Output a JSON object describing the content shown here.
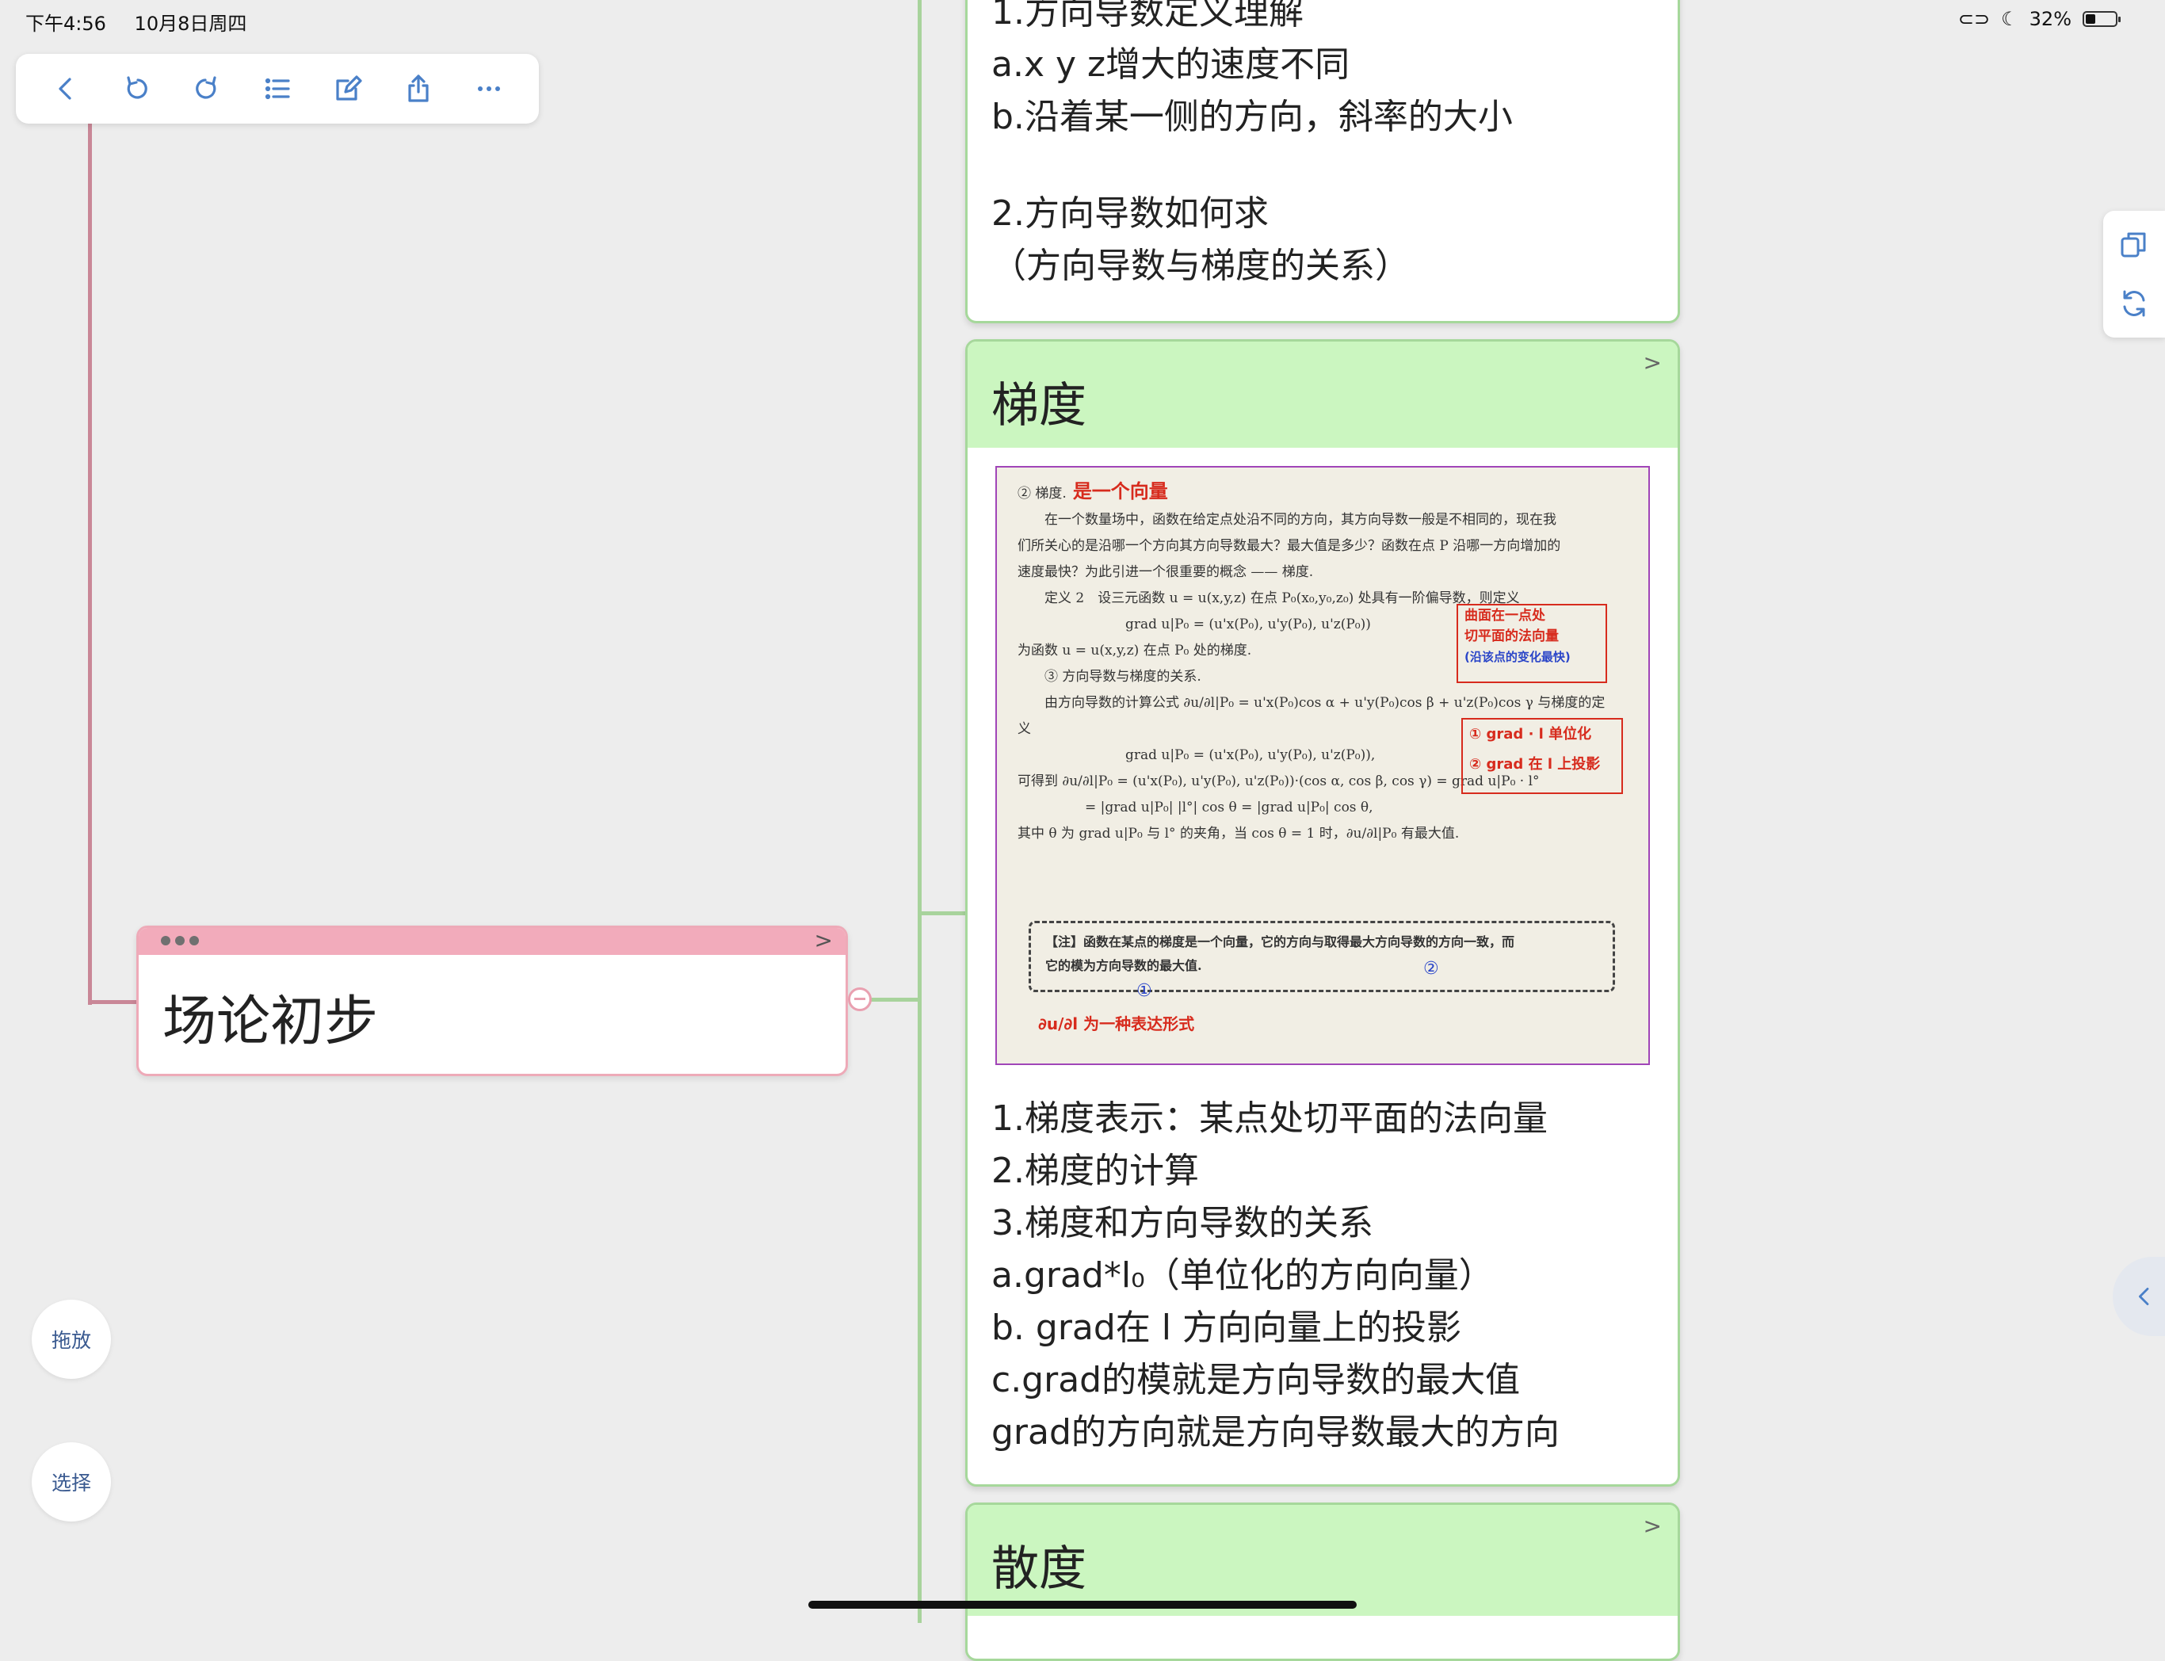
{
  "status_bar": {
    "time": "下午4:56",
    "date": "10月8日周四",
    "battery": "32%",
    "battery_level": 0.32
  },
  "toolbar": {
    "icons": [
      "chevron-left-icon",
      "undo-icon",
      "redo-icon",
      "list-icon",
      "edit-icon",
      "share-icon",
      "more-icon"
    ]
  },
  "root_node": {
    "title": "场论初步"
  },
  "cards": [
    {
      "lines": [
        "1.方向导数定义理解",
        "a.x y z增大的速度不同",
        "b.沿着某一侧的方向，斜率的大小",
        "",
        "2.方向导数如何求",
        "（方向导数与梯度的关系）"
      ]
    },
    {
      "title": "梯度",
      "lines": [
        "1.梯度表示：某点处切平面的法向量",
        "2.梯度的计算",
        "3.梯度和方向导数的关系",
        "a.grad*l₀（单位化的方向向量）",
        "b. grad在 l 方向向量上的投影",
        "c.grad的模就是方向导数的最大值",
        "  grad的方向就是方向导数最大的方向"
      ]
    },
    {
      "title": "散度"
    }
  ],
  "scan": {
    "lines": [
      "② 梯度.",
      "　　在一个数量场中，函数在给定点处沿不同的方向，其方向导数一般是不相同的，现在我",
      "们所关心的是沿哪一个方向其方向导数最大？最大值是多少？函数在点 P 沿哪一方向增加的",
      "速度最快？为此引进一个很重要的概念 —— 梯度.",
      "　　定义 2　设三元函数 u = u(x,y,z) 在点 P₀(x₀,y₀,z₀) 处具有一阶偏导数，则定义",
      "　　　　　　　　grad u|P₀ = (u'x(P₀), u'y(P₀), u'z(P₀))",
      "为函数 u = u(x,y,z) 在点 P₀ 处的梯度.",
      "　　③ 方向导数与梯度的关系.",
      "　　由方向导数的计算公式 ∂u/∂l|P₀ = u'x(P₀)cos α + u'y(P₀)cos β + u'z(P₀)cos γ 与梯度的定",
      "义",
      "　　　　　　　　grad u|P₀ = (u'x(P₀), u'y(P₀), u'z(P₀)),",
      "可得到 ∂u/∂l|P₀ = (u'x(P₀), u'y(P₀), u'z(P₀))·(cos α, cos β, cos γ) = grad u|P₀ · l°",
      "　　　　　= |grad u|P₀| |l°| cos θ = |grad u|P₀| cos θ,",
      "其中 θ 为 grad u|P₀ 与 l° 的夹角，当 cos θ = 1 时，∂u/∂l|P₀ 有最大值."
    ],
    "note_lines": [
      "【注】函数在某点的梯度是一个向量，它的方向与取得最大方向导数的方向一致，而",
      "它的模为方向导数的最大值."
    ],
    "annotations": {
      "gradient_is": "是一个向量",
      "box1": [
        "曲面在一点处",
        "切平面的法向量",
        "(沿该点的变化最快)"
      ],
      "box2": [
        "① grad · l 单位化",
        "② grad 在 l 上投影"
      ],
      "bottom": "∂u/∂l 为一种表达形式",
      "blue_marks": [
        "①",
        "②"
      ]
    }
  },
  "side_tools": {
    "icons": [
      "copy-icon",
      "refresh-icon"
    ]
  },
  "left_buttons": {
    "drag": "拖放",
    "select": "选择"
  }
}
